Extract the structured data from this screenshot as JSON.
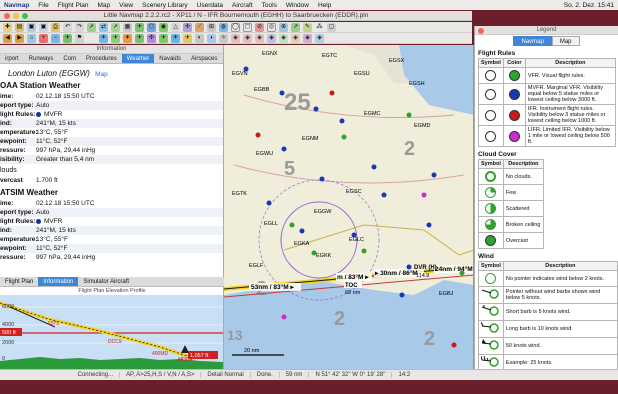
{
  "menu": {
    "app": "Navmap",
    "items": [
      "File",
      "Flight Plan",
      "Map",
      "View",
      "Scenery Library",
      "Userdata",
      "Aircraft",
      "Tools",
      "Window",
      "Help"
    ],
    "clock": "So. 2. Dez. 15:41"
  },
  "window_title": "Little Navmap 2.2.2.rc2 - XP11 / N - IFR Bournemouth (EGHH) to Saarbruecken (EDDR).pln",
  "info": {
    "header": "Information",
    "tabs": [
      "irport",
      "Runways",
      "Com",
      "Procedures",
      "Weather",
      "Navaids",
      "Airspaces"
    ],
    "active_tab": "Weather",
    "airport_name": "London Luton (EGGW)",
    "map_link": "Map",
    "noaa_title": "OAA Station Weather",
    "noaa_rows": [
      {
        "k": "ime:",
        "v": "02.12.18 15:50 UTC"
      },
      {
        "k": "eport type:",
        "v": "Auto"
      },
      {
        "k": "light Rules:",
        "v": "MVFR"
      },
      {
        "k": "ind:",
        "v": "241°M, 15 kts"
      },
      {
        "k": "emperature:",
        "v": "13°C, 55°F"
      },
      {
        "k": "ewpoint:",
        "v": "11°C, 52°F"
      },
      {
        "k": "ressure:",
        "v": "997 hPa, 29,44 inHg"
      },
      {
        "k": "isibility:",
        "v": "Greater than 5,4 nm"
      }
    ],
    "clouds_title": "louds",
    "clouds_row": {
      "k": "vercast",
      "v": "1.700 ft"
    },
    "xp_title": "ATSIM Weather",
    "xp_rows": [
      {
        "k": "ime:",
        "v": "02.12.18 15:50 UTC"
      },
      {
        "k": "eport type:",
        "v": "Auto"
      },
      {
        "k": "light Rules:",
        "v": "MVFR"
      },
      {
        "k": "ind:",
        "v": "241°M, 15 kts"
      },
      {
        "k": "emperature:",
        "v": "13°C, 55°F"
      },
      {
        "k": "ewpoint:",
        "v": "11°C, 52°F"
      },
      {
        "k": "ressure:",
        "v": "997 hPa, 29,44 inHg"
      }
    ]
  },
  "bottom_tabs": [
    "Flight Plan",
    "Information",
    "Simulator Aircraft"
  ],
  "bottom_active": "Information",
  "profile": {
    "title": "Flight Plan Elevation Profile",
    "y_labels": [
      "6000",
      "4000",
      "2000",
      "0"
    ],
    "tag_left": "500 ft",
    "tag_right": "1,057 ft",
    "labels": [
      "6375",
      "DCC9",
      "400MD",
      "MDDR"
    ]
  },
  "map": {
    "airports": [
      "EGNX",
      "EGTC",
      "EGSX",
      "EGVN",
      "EGSU",
      "EGMC",
      "EGMD",
      "EGLL",
      "EGKA",
      "EGSC",
      "EGTK",
      "EGBB",
      "EGLF",
      "EGKK",
      "EGWU",
      "EGGW",
      "EGLC",
      "EGSH",
      "EGNM",
      "EGBJ"
    ],
    "leg1": "53nm / 83°M ▸",
    "leg2": "m / 83°M ▸",
    "leg3": "▸ 30nm / 86°M",
    "leg4": "24nm / 94°M",
    "toc": "TOC",
    "toc_dist": "68 nm",
    "scale": "20 nm",
    "dvr": "DVR (H)",
    "dvr_freq": "114.9"
  },
  "legend": {
    "window_title": "Legend",
    "tabs": [
      "Navmap",
      "Map"
    ],
    "active_tab": "Navmap",
    "flight_rules_title": "Flight Rules",
    "fr_headers": [
      "Symbol",
      "Color",
      "Description"
    ],
    "flight_rules": [
      {
        "color": "#2fa22f",
        "desc": "VFR. Visual flight rules."
      },
      {
        "color": "#1c36b8",
        "desc": "MVFR. Marginal VFR. Visibility equal below 5 statue miles or lowest ceiling below 3000 ft."
      },
      {
        "color": "#c81a1a",
        "desc": "IFR. Instrument flight rules. Visibility below 3 statue miles or lowest ceiling below 1000 ft."
      },
      {
        "color": "#cc2ad0",
        "desc": "LIFR. Limited IFR. Visibility below 1 mile or lowest ceiling below 500 ft."
      }
    ],
    "cloud_title": "Cloud Cover",
    "cc_headers": [
      "Symbol",
      "Description"
    ],
    "cloud_cover": [
      "No clouds.",
      "Few",
      "Scattered",
      "Broken ceiling",
      "Overcast"
    ],
    "wind_title": "Wind",
    "wind_headers": [
      "Symbol",
      "Description"
    ],
    "wind": [
      "No pointer indicates wind below 2 knots.",
      "Pointer without wind barbs shows wind below 5 knots.",
      "Short barb is 5 knots wind.",
      "Long barb is 10 knots wind.",
      "50 knots wind.",
      "Example: 25 knots."
    ]
  },
  "status": [
    "Connecting...",
    "AP, A>25,H,S / V,N / A,S>",
    "Detail Normal",
    "Done.",
    "59 nm",
    "N 51° 42' 32'' W 0° 19' 28''",
    "14:2"
  ]
}
